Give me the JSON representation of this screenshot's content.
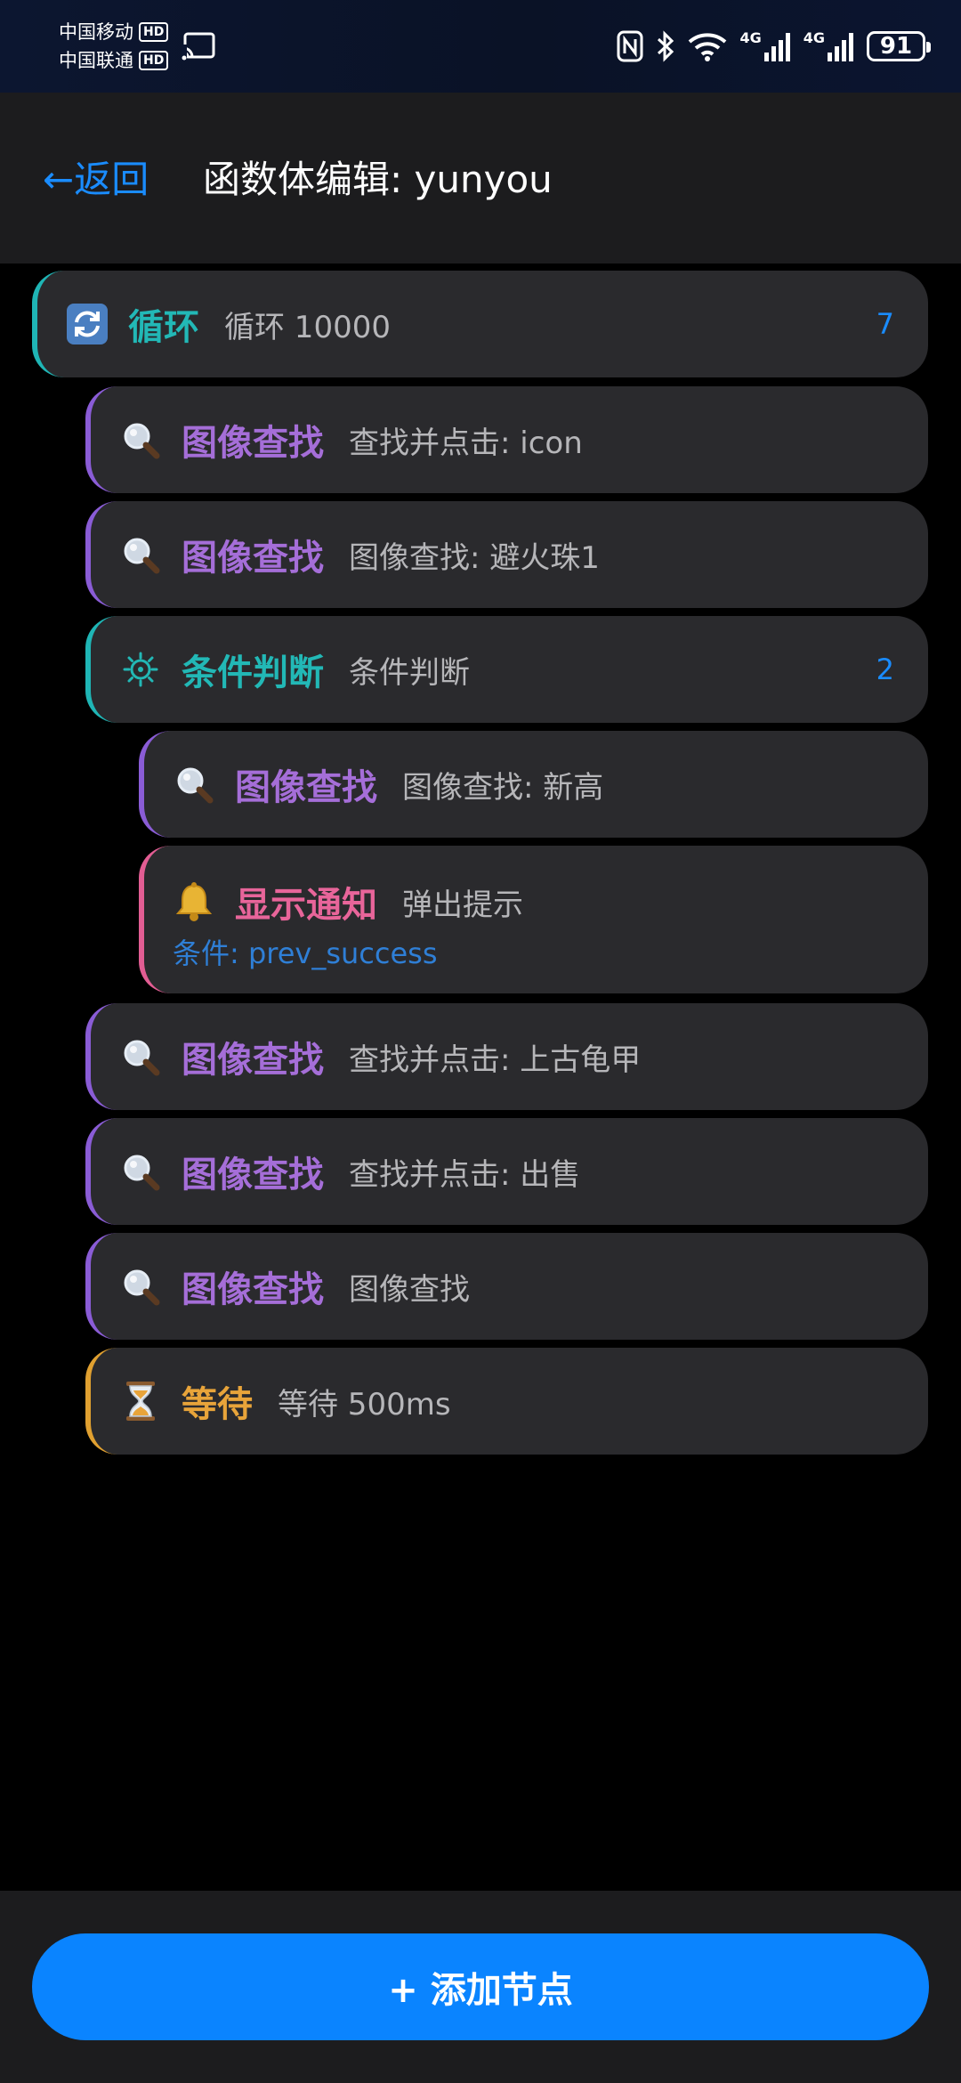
{
  "statusbar": {
    "carrier1": "中国移动",
    "carrier2": "中国联通",
    "hd": "HD",
    "net1": "4G",
    "net2": "4G",
    "battery": "91"
  },
  "header": {
    "back_label": "←返回",
    "title": "函数体编辑: yunyou"
  },
  "nodes": [
    {
      "label": "循环",
      "desc": "循环 10000",
      "count": "7",
      "icon": "loop-icon"
    },
    {
      "label": "图像查找",
      "desc": "查找并点击: icon",
      "icon": "magnifier-icon"
    },
    {
      "label": "图像查找",
      "desc": "图像查找: 避火珠1",
      "icon": "magnifier-icon"
    },
    {
      "label": "条件判断",
      "desc": "条件判断",
      "count": "2",
      "icon": "gear-icon"
    },
    {
      "label": "图像查找",
      "desc": "图像查找: 新高",
      "icon": "magnifier-icon"
    },
    {
      "label": "显示通知",
      "desc": "弹出提示",
      "condition": "条件: prev_success",
      "icon": "bell-icon"
    },
    {
      "label": "图像查找",
      "desc": "查找并点击: 上古龟甲",
      "icon": "magnifier-icon"
    },
    {
      "label": "图像查找",
      "desc": "查找并点击: 出售",
      "icon": "magnifier-icon"
    },
    {
      "label": "图像查找",
      "desc": "图像查找",
      "icon": "magnifier-icon"
    },
    {
      "label": "等待",
      "desc": "等待 500ms",
      "icon": "hourglass-icon"
    }
  ],
  "add_button": "+ 添加节点",
  "colors": {
    "accent": "#0a84ff",
    "loop": "#22b8b6",
    "image": "#a56ed8",
    "notify": "#e8659a",
    "wait": "#e8a43a"
  }
}
